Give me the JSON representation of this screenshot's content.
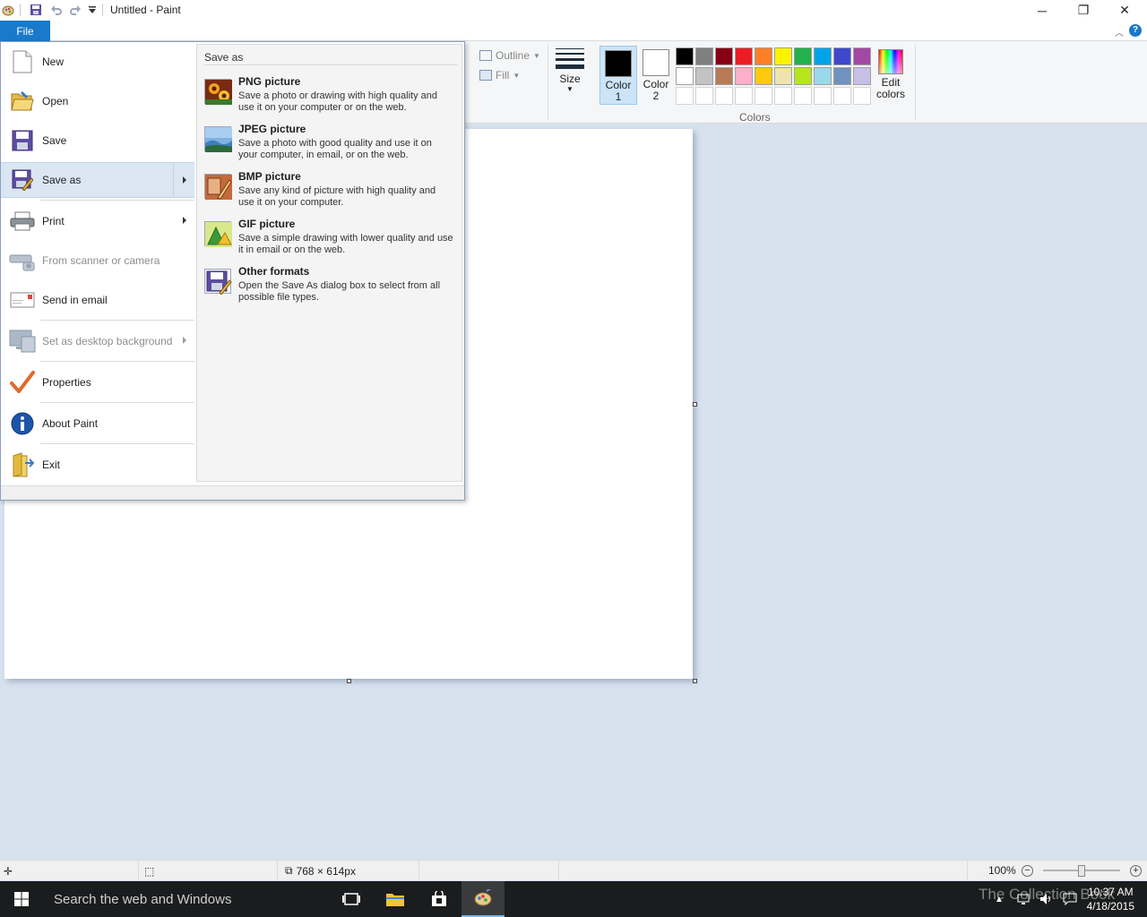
{
  "window": {
    "title": "Untitled - Paint",
    "minimize": "─",
    "maximize": "❐",
    "close": "✕"
  },
  "ribbon": {
    "file_tab": "File",
    "outline_label": "Outline",
    "fill_label": "Fill",
    "size_label": "Size",
    "color1_line1": "Color",
    "color1_line2": "1",
    "color2_line1": "Color",
    "color2_line2": "2",
    "edit_colors_line1": "Edit",
    "edit_colors_line2": "colors",
    "colors_group_label": "Colors",
    "color1_value": "#000000",
    "color2_value": "#ffffff",
    "palette": [
      "#000000",
      "#7f7f7f",
      "#880015",
      "#ed1c24",
      "#ff7f27",
      "#fff200",
      "#22b14c",
      "#00a2e8",
      "#3f48cc",
      "#a349a4",
      "#ffffff",
      "#c3c3c3",
      "#b97a57",
      "#ffaec9",
      "#ffc90e",
      "#efe4b0",
      "#b5e61d",
      "#99d9ea",
      "#7092be",
      "#c8bfe7",
      "#ffffff",
      "#ffffff",
      "#ffffff",
      "#ffffff",
      "#ffffff",
      "#ffffff",
      "#ffffff",
      "#ffffff",
      "#ffffff",
      "#ffffff"
    ]
  },
  "file_menu": {
    "items": [
      {
        "label": "New",
        "icon": "new-document-icon",
        "enabled": true,
        "submenu": false
      },
      {
        "label": "Open",
        "icon": "open-folder-icon",
        "enabled": true,
        "submenu": false
      },
      {
        "label": "Save",
        "icon": "save-disk-icon",
        "enabled": true,
        "submenu": false
      },
      {
        "label": "Save as",
        "icon": "save-as-icon",
        "enabled": true,
        "submenu": true
      },
      {
        "label": "Print",
        "icon": "printer-icon",
        "enabled": true,
        "submenu": true
      },
      {
        "label": "From scanner or camera",
        "icon": "scanner-icon",
        "enabled": false,
        "submenu": false
      },
      {
        "label": "Send in email",
        "icon": "email-icon",
        "enabled": true,
        "submenu": false
      },
      {
        "label": "Set as desktop background",
        "icon": "desktop-icon",
        "enabled": false,
        "submenu": true
      },
      {
        "label": "Properties",
        "icon": "checkmark-icon",
        "enabled": true,
        "submenu": false
      },
      {
        "label": "About Paint",
        "icon": "info-icon",
        "enabled": true,
        "submenu": false
      },
      {
        "label": "Exit",
        "icon": "exit-icon",
        "enabled": true,
        "submenu": false
      }
    ],
    "save_as": {
      "heading": "Save as",
      "options": [
        {
          "title": "PNG picture",
          "desc": "Save a photo or drawing with high quality and use it on your computer or on the web.",
          "icon": "png-icon"
        },
        {
          "title": "JPEG picture",
          "desc": "Save a photo with good quality and use it on your computer, in email, or on the web.",
          "icon": "jpeg-icon"
        },
        {
          "title": "BMP picture",
          "desc": "Save any kind of picture with high quality and use it on your computer.",
          "icon": "bmp-icon"
        },
        {
          "title": "GIF picture",
          "desc": "Save a simple drawing with lower quality and use it in email or on the web.",
          "icon": "gif-icon"
        },
        {
          "title": "Other formats",
          "desc": "Open the Save As dialog box to select from all possible file types.",
          "icon": "other-formats-icon"
        }
      ]
    }
  },
  "statusbar": {
    "image_size": "768 × 614px",
    "zoom": "100%",
    "zoom_out": "−",
    "zoom_in": "+"
  },
  "taskbar": {
    "search_placeholder": "Search the web and Windows",
    "time": "10:37 AM",
    "date": "4/18/2015",
    "watermark": "The Collection Book"
  }
}
